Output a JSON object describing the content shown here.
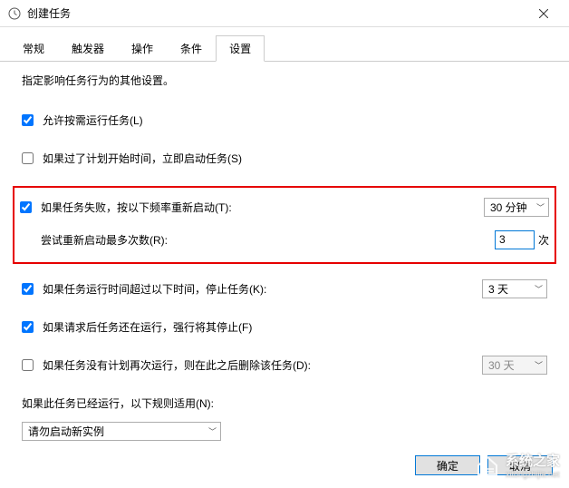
{
  "window": {
    "title": "创建任务"
  },
  "tabs": {
    "items": [
      {
        "label": "常规"
      },
      {
        "label": "触发器"
      },
      {
        "label": "操作"
      },
      {
        "label": "条件"
      },
      {
        "label": "设置"
      }
    ],
    "active_index": 4
  },
  "content": {
    "subtitle": "指定影响任务行为的其他设置。",
    "allow_demand_run": {
      "checked": true,
      "label": "允许按需运行任务(L)"
    },
    "run_if_missed": {
      "checked": false,
      "label": "如果过了计划开始时间，立即启动任务(S)"
    },
    "restart_on_failure": {
      "checked": true,
      "label": "如果任务失败，按以下频率重新启动(T):",
      "interval": "30 分钟",
      "retry_label": "尝试重新启动最多次数(R):",
      "retry_count": "3",
      "retry_suffix": "次"
    },
    "stop_if_runs_longer": {
      "checked": true,
      "label": "如果任务运行时间超过以下时间，停止任务(K):",
      "duration": "3 天"
    },
    "force_stop": {
      "checked": true,
      "label": "如果请求后任务还在运行，强行将其停止(F)"
    },
    "delete_after": {
      "checked": false,
      "label": "如果任务没有计划再次运行，则在此之后删除该任务(D):",
      "value": "30 天"
    },
    "if_running_label": "如果此任务已经运行，以下规则适用(N):",
    "if_running_rule": "请勿启动新实例"
  },
  "buttons": {
    "ok": "确定",
    "cancel": "取消"
  },
  "watermark": {
    "text": "系统之家",
    "url": "xitongzhijia.net"
  }
}
